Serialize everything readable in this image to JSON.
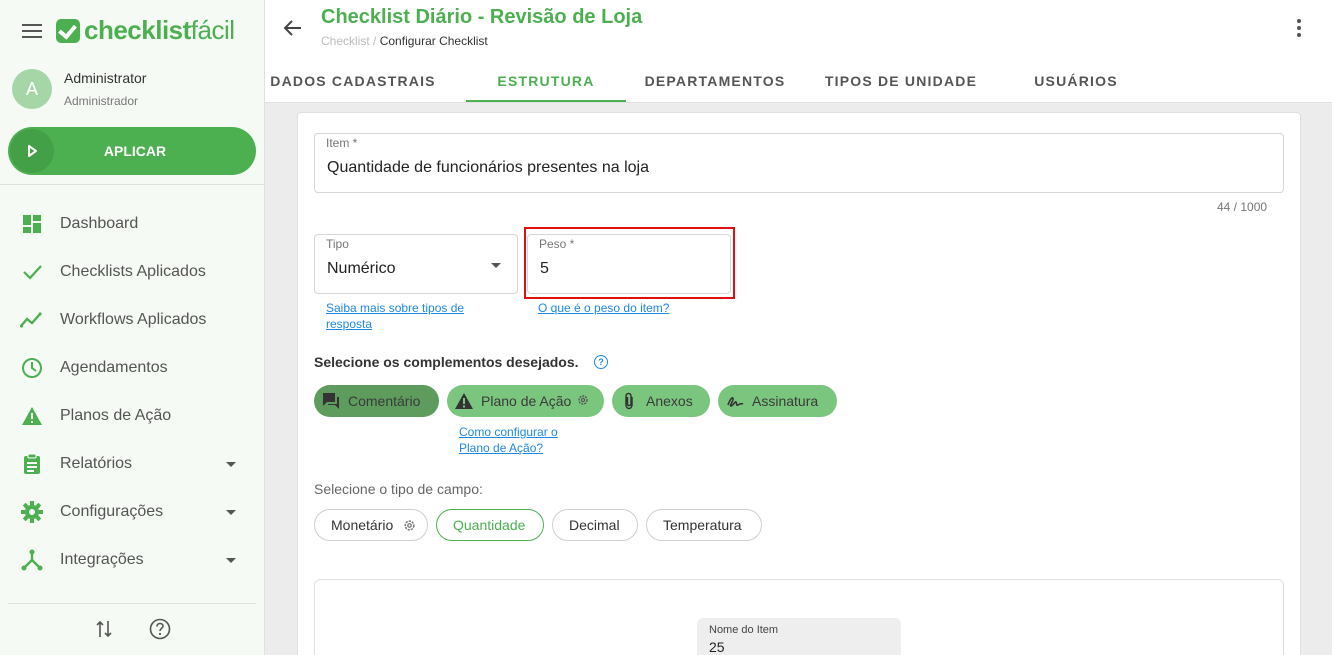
{
  "app": {
    "logo_bold": "checklist",
    "logo_light": "fácil"
  },
  "user": {
    "initial": "A",
    "name": "Administrator",
    "role": "Administrador"
  },
  "sidebar": {
    "apply_label": "APLICAR",
    "items": [
      {
        "label": "Dashboard",
        "icon": "dashboard-icon"
      },
      {
        "label": "Checklists Aplicados",
        "icon": "check-icon"
      },
      {
        "label": "Workflows Aplicados",
        "icon": "trend-icon"
      },
      {
        "label": "Agendamentos",
        "icon": "clock-icon"
      },
      {
        "label": "Planos de Ação",
        "icon": "warning-icon"
      },
      {
        "label": "Relatórios",
        "icon": "clipboard-icon"
      },
      {
        "label": "Configurações",
        "icon": "gear-icon"
      },
      {
        "label": "Integrações",
        "icon": "integration-icon"
      }
    ]
  },
  "header": {
    "title": "Checklist Diário - Revisão de Loja",
    "breadcrumb_parent": "Checklist",
    "breadcrumb_separator": "/",
    "breadcrumb_current": "Configurar Checklist"
  },
  "tabs": [
    {
      "label": "DADOS CADASTRAIS"
    },
    {
      "label": "ESTRUTURA"
    },
    {
      "label": "DEPARTAMENTOS"
    },
    {
      "label": "TIPOS DE UNIDADE"
    },
    {
      "label": "USUÁRIOS"
    }
  ],
  "form": {
    "item_label": "Item *",
    "item_value": "Quantidade de funcionários presentes na loja",
    "item_counter": "44 / 1000",
    "tipo_label": "Tipo",
    "tipo_value": "Numérico",
    "tipo_help_line1": "Saiba mais sobre tipos de",
    "tipo_help_line2": "resposta",
    "peso_label": "Peso *",
    "peso_value": "5",
    "peso_help": "O que é o peso do item?",
    "complements_title": "Selecione os complementos desejados.",
    "complements": [
      {
        "label": "Comentário",
        "icon": "comment-icon"
      },
      {
        "label": "Plano de Ação",
        "icon": "warning-icon"
      },
      {
        "label": "Anexos",
        "icon": "attachment-icon"
      },
      {
        "label": "Assinatura",
        "icon": "signature-icon"
      }
    ],
    "plan_help_line1": "Como configurar o",
    "plan_help_line2": "Plano de Ação?",
    "field_type_title": "Selecione o tipo de campo:",
    "field_types": [
      {
        "label": "Monetário"
      },
      {
        "label": "Quantidade"
      },
      {
        "label": "Decimal"
      },
      {
        "label": "Temperatura"
      }
    ]
  },
  "preview": {
    "label": "Nome do Item",
    "value": "25"
  },
  "colors": {
    "brand": "#4caf50",
    "link": "#1e88e5",
    "highlight": "#e01010"
  }
}
